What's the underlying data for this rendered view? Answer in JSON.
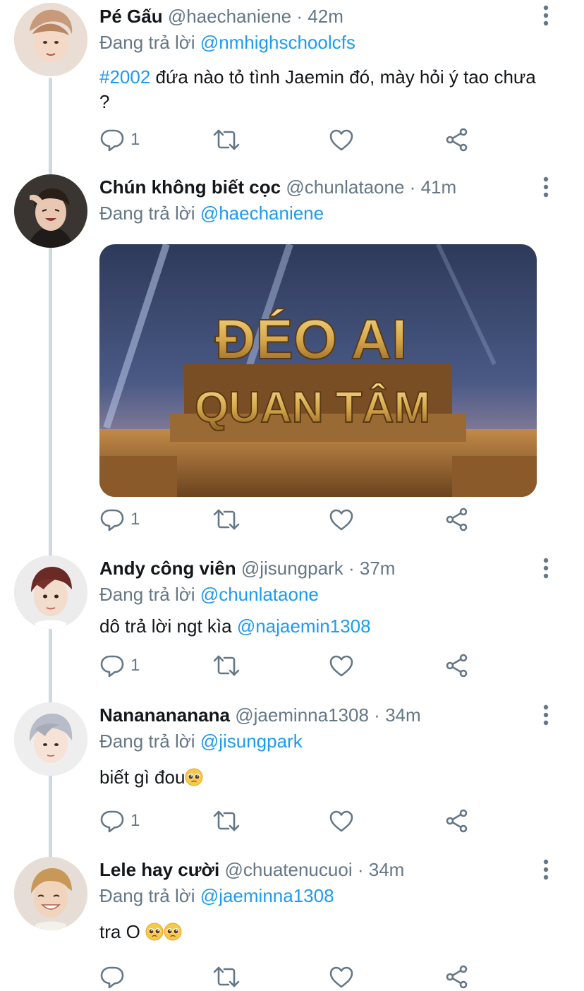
{
  "tweets": [
    {
      "name": "Pé Gấu",
      "handle": "@haechaniene",
      "time": "42m",
      "reply_prefix": "Đang trả lời",
      "reply_to": "@nmhighschoolcfs",
      "hashtag": "#2002",
      "text": " đứa nào tỏ tình Jaemin đó, mày hỏi ý tao chưa ?",
      "reply_count": "1"
    },
    {
      "name": "Chún không biết cọc",
      "handle": "@chunlataone",
      "time": "41m",
      "reply_prefix": "Đang trả lời",
      "reply_to": "@haechaniene",
      "media_text_line1": "ĐÉO AI",
      "media_text_line2": "QUAN TÂM",
      "reply_count": "1"
    },
    {
      "name": "Andy công viên",
      "handle": "@jisungpark",
      "time": "37m",
      "reply_prefix": "Đang trả lời",
      "reply_to": "@chunlataone",
      "text": "dô trả lời ngt kìa ",
      "text_mention": "@najaemin1308",
      "reply_count": "1"
    },
    {
      "name": "Nananananana",
      "handle": "@jaeminna1308",
      "time": "34m",
      "reply_prefix": "Đang trả lời",
      "reply_to": "@jisungpark",
      "text": "biết gì đou",
      "reply_count": "1"
    },
    {
      "name": "Lele hay cười",
      "handle": "@chuatenucuoi",
      "time": "34m",
      "reply_prefix": "Đang trả lời",
      "reply_to": "@jaeminna1308",
      "text": "tra O ",
      "reply_count": ""
    }
  ],
  "separator": "·",
  "icons": {
    "reply": "reply-icon",
    "retweet": "retweet-icon",
    "like": "heart-icon",
    "share": "share-icon",
    "more": "more-vertical-icon",
    "emoji": "pleading-face-emoji"
  },
  "colors": {
    "link": "#1d9bf0",
    "secondary_text": "#657786",
    "thread_line": "#cfd9de"
  }
}
